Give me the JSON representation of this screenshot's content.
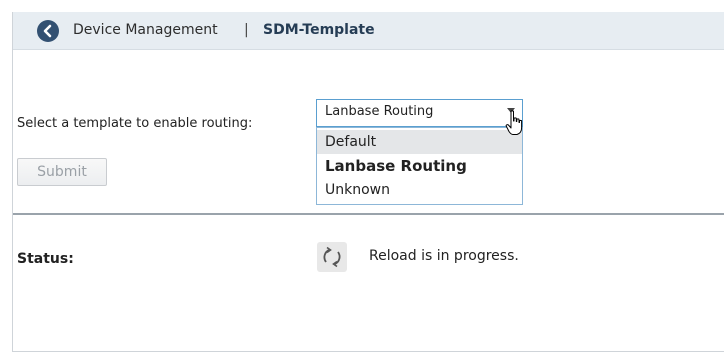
{
  "header": {
    "back_icon": "chevron-left-circle-icon",
    "breadcrumb_parent": "Device Management",
    "breadcrumb_separator": "|",
    "breadcrumb_current": "SDM-Template"
  },
  "form": {
    "select_label": "Select a template to enable routing:",
    "select_value": "Lanbase Routing",
    "options": [
      "Default",
      "Lanbase Routing",
      "Unknown"
    ],
    "hovered_option": "Default",
    "selected_option": "Lanbase Routing",
    "submit_label": "Submit",
    "submit_disabled": true
  },
  "status": {
    "label": "Status:",
    "icon": "refresh-icon",
    "text": "Reload is in progress."
  },
  "colors": {
    "header_bg": "#e7edf2",
    "back_button": "#335172",
    "select_border": "#5a9fd0",
    "hover_option_bg": "#e4e6e8",
    "divider": "#9aa3ab"
  }
}
